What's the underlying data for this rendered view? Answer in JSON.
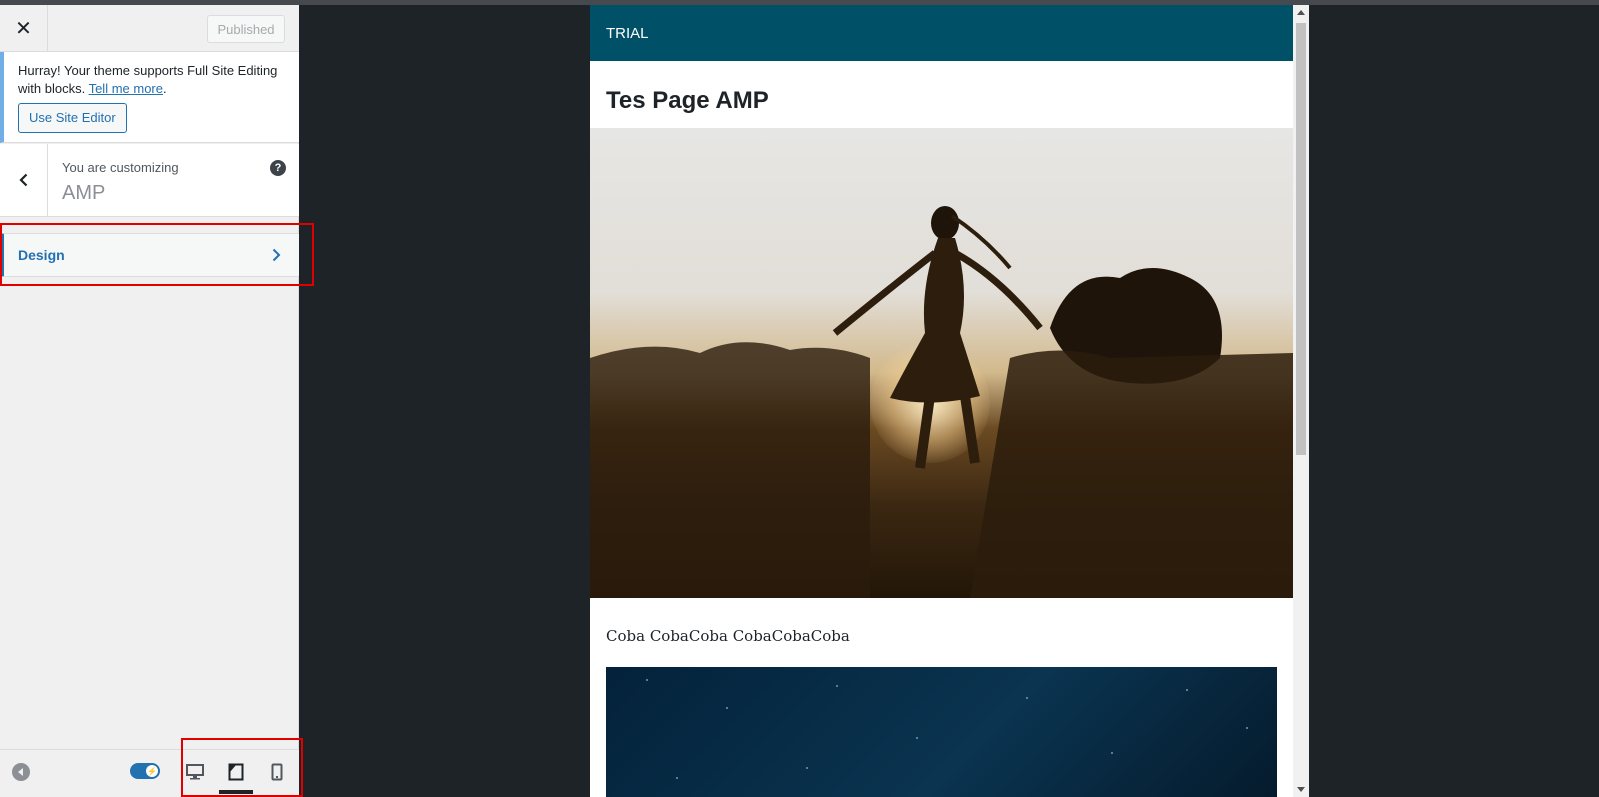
{
  "sidebar": {
    "close_label": "✕",
    "publish_label": "Published",
    "notice": {
      "text": "Hurray! Your theme supports Full Site Editing with blocks. ",
      "link": "Tell me more",
      "suffix": ".",
      "button": "Use Site Editor"
    },
    "customizing": {
      "label": "You are customizing",
      "title": "AMP",
      "help": "?"
    },
    "sections": [
      {
        "label": "Design"
      }
    ],
    "footer": {
      "devices": [
        "desktop",
        "tablet",
        "mobile"
      ],
      "active_device": "tablet"
    }
  },
  "preview": {
    "site_title": "TRIAL",
    "page_title": "Tes Page AMP",
    "paragraph": "Coba CobaCoba CobaCobaCoba"
  },
  "colors": {
    "accent": "#2271b1",
    "header_bg": "#005068",
    "highlight": "#e00000",
    "backdrop": "#1d2327"
  }
}
